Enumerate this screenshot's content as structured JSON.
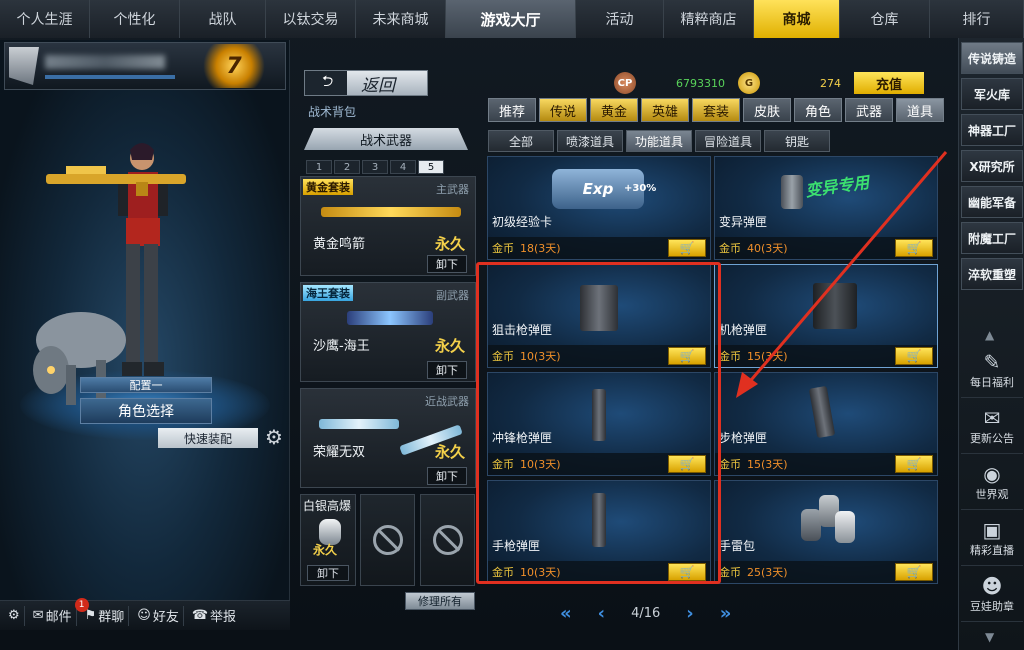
{
  "topnav": [
    "个人生涯",
    "个性化",
    "战队",
    "以钛交易",
    "未来商城",
    "游戏大厅",
    "活动",
    "精粹商店",
    "商城",
    "仓库",
    "排行"
  ],
  "profile": {
    "rank": "7"
  },
  "character": {
    "loadout_label": "配置一",
    "select_role": "角色选择",
    "quick_equip": "快速装配"
  },
  "bottombar": {
    "mail": "邮件",
    "mail_badge": "1",
    "group": "群聊",
    "friends": "好友",
    "report": "举报"
  },
  "mid": {
    "back": "返回",
    "bag_label": "战术背包",
    "weapons_header": "战术武器",
    "pages": [
      "1",
      "2",
      "3",
      "4",
      "5"
    ],
    "weapons": [
      {
        "tag": "黄金套装",
        "type": "主武器",
        "name": "黄金鸣箭",
        "perm": "永久",
        "unload": "卸下"
      },
      {
        "tag": "海王套装",
        "type": "副武器",
        "name": "沙鹰-海王",
        "perm": "永久",
        "unload": "卸下"
      },
      {
        "tag": "",
        "type": "近战武器",
        "name": "荣耀无双",
        "perm": "永久",
        "unload": "卸下"
      }
    ],
    "grenade": {
      "name": "白银高爆",
      "perm": "永久",
      "unload": "卸下"
    },
    "repair_all": "修理所有"
  },
  "currency": {
    "cp_icon": "CP",
    "cp": "6793310",
    "gold_icon": "G",
    "gold": "274",
    "recharge": "充值"
  },
  "tabs1": [
    "推荐",
    "传说",
    "黄金",
    "英雄",
    "套装",
    "皮肤",
    "角色",
    "武器",
    "道具"
  ],
  "tabs2": [
    "全部",
    "喷漆道具",
    "功能道具",
    "冒险道具",
    "钥匙"
  ],
  "items": [
    {
      "name": "初级经验卡",
      "badge": "Exp",
      "bonus": "+30%",
      "cur": "金币",
      "price": "18(3天)"
    },
    {
      "name": "变异弹匣",
      "badge": "变异专用",
      "cur": "金币",
      "price": "40(3天)"
    },
    {
      "name": "狙击枪弹匣",
      "cur": "金币",
      "price": "10(3天)"
    },
    {
      "name": "机枪弹匣",
      "cur": "金币",
      "price": "15(3天)"
    },
    {
      "name": "冲锋枪弹匣",
      "cur": "金币",
      "price": "10(3天)"
    },
    {
      "name": "步枪弹匣",
      "cur": "金币",
      "price": "15(3天)"
    },
    {
      "name": "手枪弹匣",
      "cur": "金币",
      "price": "10(3天)"
    },
    {
      "name": "手雷包",
      "cur": "金币",
      "price": "25(3天)"
    }
  ],
  "pager": {
    "text": "4/16"
  },
  "rightbar": {
    "buttons": [
      "传说铸造",
      "军火库",
      "神器工厂",
      "X研究所",
      "幽能军备",
      "附魔工厂",
      "淬软重塑"
    ],
    "icons": [
      "每日福利",
      "更新公告",
      "世界观",
      "精彩直播",
      "豆娃助章"
    ]
  }
}
